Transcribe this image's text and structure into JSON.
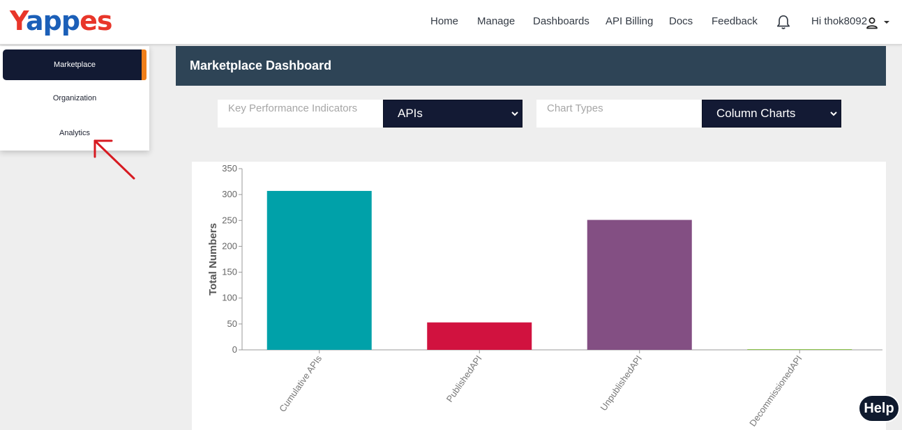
{
  "brand": {
    "logo_y": "Y",
    "logo_pp": "app",
    "logo_es": "es"
  },
  "nav": {
    "items": [
      "Home",
      "Manage",
      "Dashboards",
      "API Billing",
      "Docs",
      "Feedback"
    ],
    "greeting": "Hi thok8092",
    "icons": [
      "bell-icon",
      "user-icon",
      "caret-down-icon"
    ]
  },
  "sidebar": {
    "items": [
      {
        "label": "Marketplace",
        "active": true
      },
      {
        "label": "Organization",
        "active": false
      },
      {
        "label": "Analytics",
        "active": false
      }
    ]
  },
  "main": {
    "title": "Marketplace Dashboard",
    "filters": {
      "kpi_label": "Key Performance Indicators",
      "kpi_value": "APIs",
      "chart_type_label": "Chart Types",
      "chart_type_value": "Column Charts"
    }
  },
  "chart_data": {
    "type": "bar",
    "categories": [
      "Cumulative APIs",
      "PublishedAPI",
      "UnpublishedAPI",
      "DecommissionedAPI"
    ],
    "values": [
      307,
      53,
      251,
      1
    ],
    "colors": [
      "#00a1a9",
      "#d1123f",
      "#834f83",
      "#8bc34a"
    ],
    "title": "",
    "xlabel": "",
    "ylabel": "Total Numbers",
    "ylim": [
      0,
      350
    ],
    "yticks": [
      0,
      50,
      100,
      150,
      200,
      250,
      300,
      350
    ],
    "grid": false
  },
  "help": {
    "label": "Help"
  },
  "colors": {
    "header_bg": "#2e4456",
    "sidebar_active": "#121a33",
    "accent": "#f07f1a",
    "annotation_arrow": "#d71a21"
  }
}
